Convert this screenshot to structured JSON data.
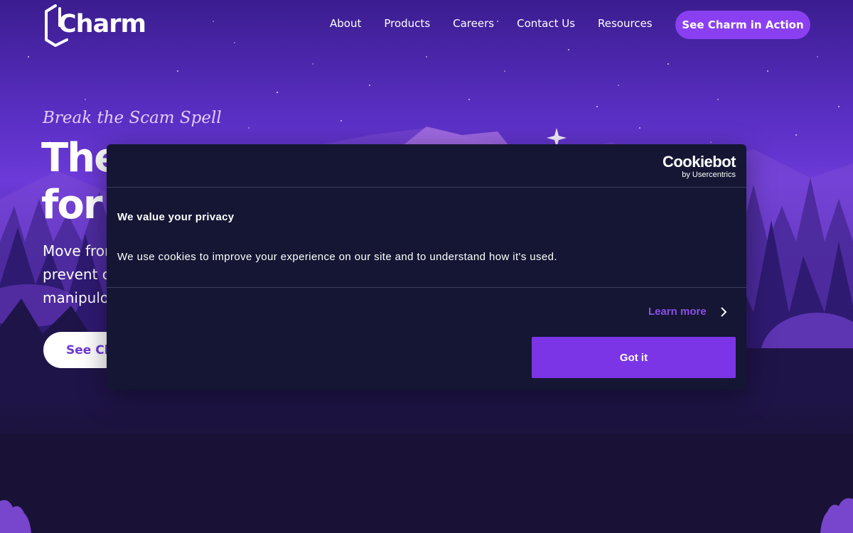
{
  "brand": {
    "logo_text": "Charm"
  },
  "nav": {
    "links": [
      "About",
      "Products",
      "Careers",
      "Contact Us",
      "Resources"
    ],
    "cta_label": "See Charm in Action"
  },
  "hero": {
    "eyebrow": "Break the Scam Spell",
    "headline_line1": "The",
    "headline_line2": "for F",
    "subcopy_line1": "Move fror",
    "subcopy_line2": "prevent c",
    "subcopy_line3": "manipulo",
    "cta_label": "See Ch"
  },
  "cookie_banner": {
    "brand_name": "Cookiebot",
    "brand_sub": "by Usercentrics",
    "title": "We value your privacy",
    "body": "We use cookies to improve your experience on our site and to understand how it's used.",
    "learn_more": "Learn more",
    "accept_label": "Got it"
  },
  "colors": {
    "accent": "#8a3ff0",
    "dialog_bg": "#141633",
    "button": "#7b35e6",
    "link": "#8a4fe8"
  },
  "icons": {
    "logo": "charm-logo-icon",
    "learn_more": "chevron-right-icon",
    "sparkle": "sparkle-icon"
  }
}
